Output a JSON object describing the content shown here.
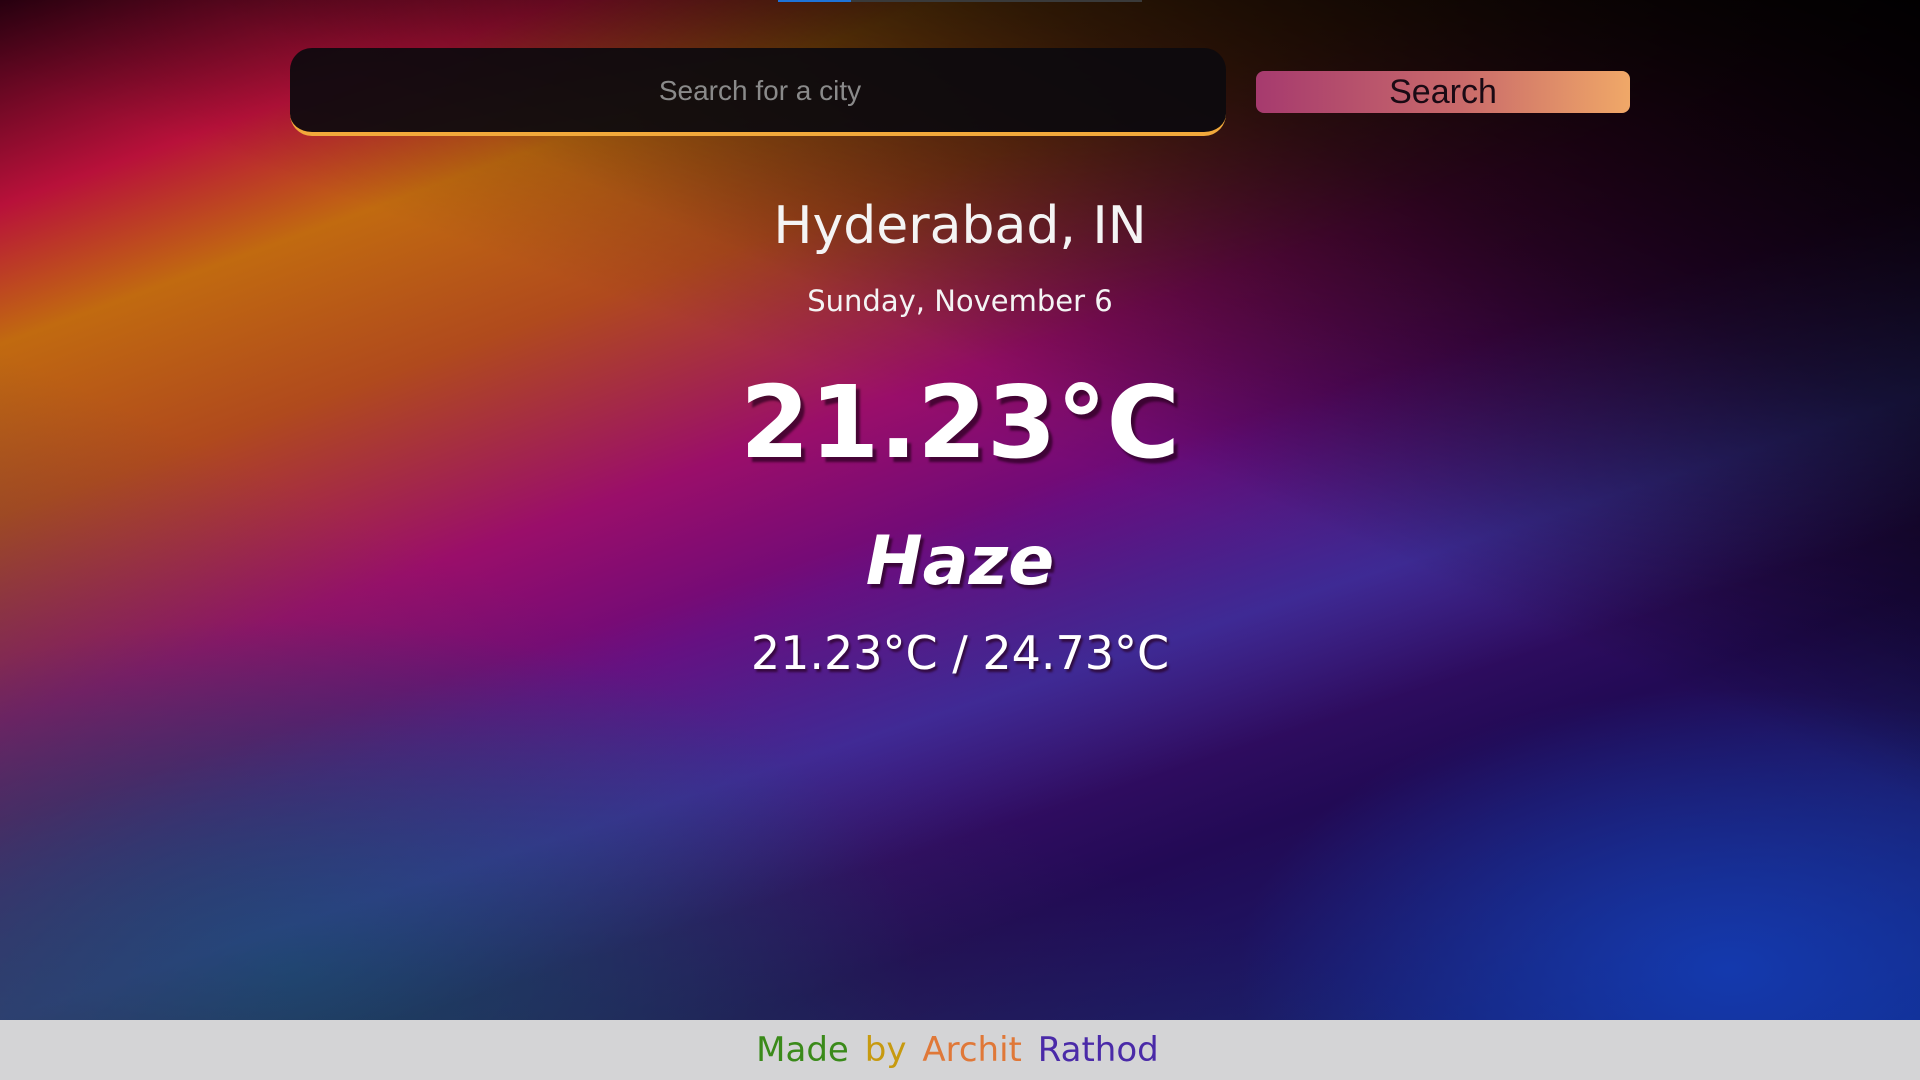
{
  "search": {
    "placeholder": "Search for a city",
    "button_label": "Search"
  },
  "weather": {
    "location": "Hyderabad, IN",
    "date": "Sunday, November 6",
    "temperature": "21.23°C",
    "condition": "Haze",
    "min_max": "21.23°C / 24.73°C"
  },
  "footer": {
    "words": [
      {
        "text": "Made",
        "color": "#3a8a1a"
      },
      {
        "text": "by",
        "color": "#c79a10"
      },
      {
        "text": "Archit",
        "color": "#e07838"
      },
      {
        "text": "Rathod",
        "color": "#4a2aa8"
      }
    ]
  },
  "colors": {
    "search_underline": "#f2a93b",
    "footer_bg": "#d4d4d6"
  }
}
